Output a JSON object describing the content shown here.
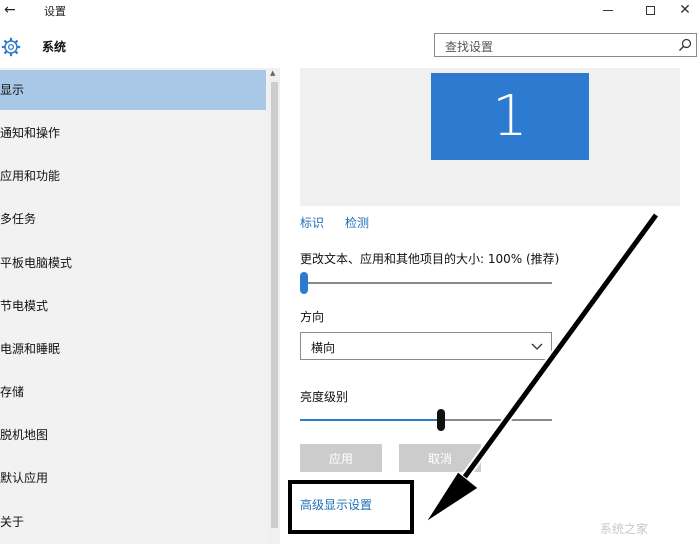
{
  "window": {
    "title": "设置"
  },
  "header": {
    "app_title": "系统",
    "search_placeholder": "查找设置"
  },
  "sidebar": {
    "items": [
      {
        "label": "显示",
        "selected": true
      },
      {
        "label": "通知和操作"
      },
      {
        "label": "应用和功能"
      },
      {
        "label": "多任务"
      },
      {
        "label": "平板电脑模式"
      },
      {
        "label": "节电模式"
      },
      {
        "label": "电源和睡眠"
      },
      {
        "label": "存储"
      },
      {
        "label": "脱机地图"
      },
      {
        "label": "默认应用"
      },
      {
        "label": "关于"
      }
    ]
  },
  "main": {
    "monitor_number": "1",
    "identify_link": "标识",
    "detect_link": "检测",
    "scale_label": "更改文本、应用和其他项目的大小: 100% (推荐)",
    "scale_value": 0,
    "orientation_label": "方向",
    "orientation_value": "横向",
    "brightness_label": "亮度级别",
    "brightness_value": 0.56,
    "apply_button": "应用",
    "cancel_button": "取消",
    "advanced_link": "高级显示设置"
  },
  "colors": {
    "accent": "#2d7ad1",
    "selected_nav": "#a9c7e6",
    "link": "#1e6fb8"
  },
  "watermark": "系统之家"
}
